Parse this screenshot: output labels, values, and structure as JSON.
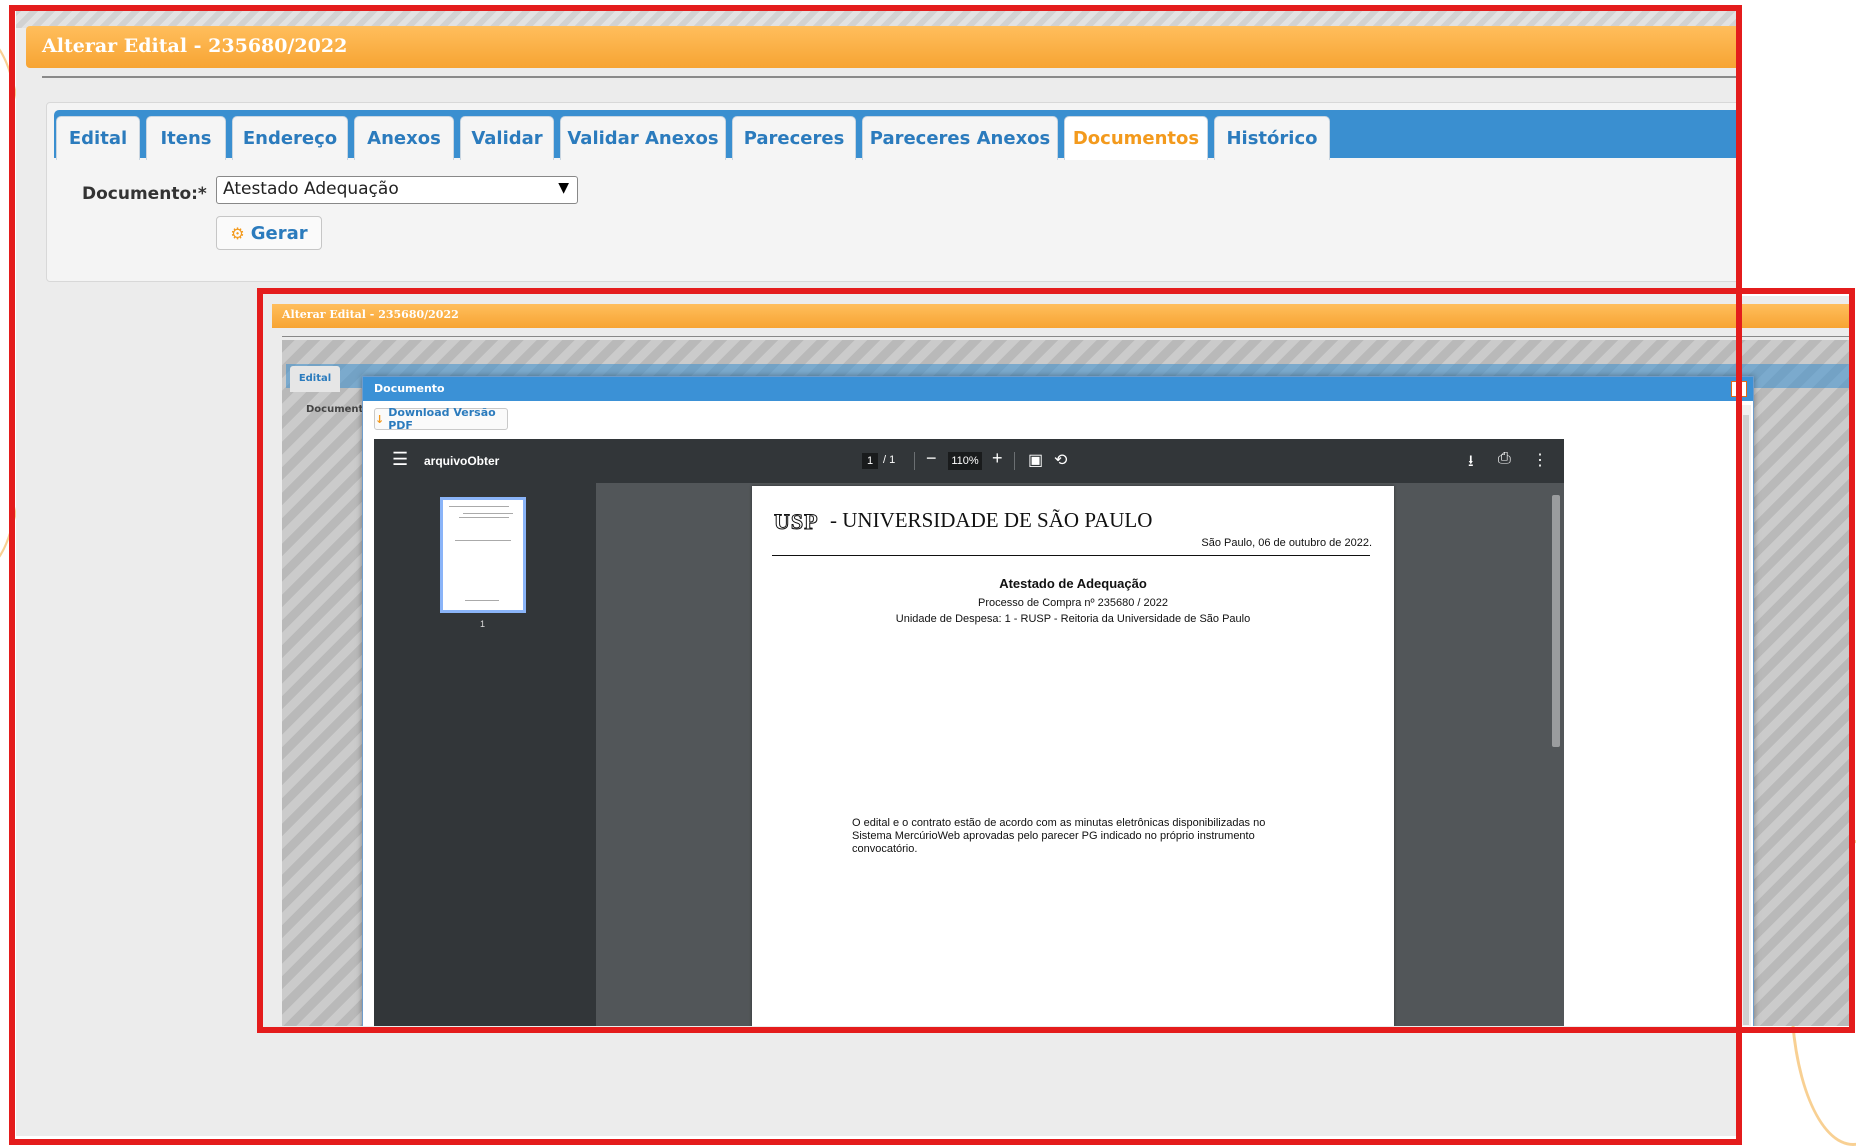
{
  "outer": {
    "title": "Alterar Edital - 235680/2022",
    "tabs": [
      {
        "label": "Edital"
      },
      {
        "label": "Itens"
      },
      {
        "label": "Endereço"
      },
      {
        "label": "Anexos"
      },
      {
        "label": "Validar"
      },
      {
        "label": "Validar Anexos"
      },
      {
        "label": "Pareceres"
      },
      {
        "label": "Pareceres Anexos"
      },
      {
        "label": "Documentos"
      },
      {
        "label": "Histórico"
      }
    ],
    "active_tab": "Documentos",
    "documento_label": "Documento:*",
    "documento_value": "Atestado Adequação",
    "gerar_label": "Gerar"
  },
  "inner": {
    "title": "Alterar Edital - 235680/2022",
    "tab_label": "Edital",
    "documento_label": "Document",
    "modal": {
      "title": "Documento",
      "close_glyph": "×",
      "download_label": "Download Versão PDF"
    },
    "viewer": {
      "file_name": "arquivoObter",
      "page_current": "1",
      "page_total": "/  1",
      "zoom": "110%",
      "thumbnail_page": "1"
    },
    "document": {
      "logo": "USP",
      "university": "- UNIVERSIDADE DE SÃO PAULO",
      "date": "São Paulo, 06 de outubro de 2022.",
      "title": "Atestado de Adequação",
      "process": "Processo de Compra nº 235680 / 2022",
      "unit": "Unidade de Despesa: 1 - RUSP - Reitoria da Universidade de São Paulo",
      "body": "O edital e o contrato estão de acordo com as minutas eletrônicas disponibilizadas no Sistema MercúrioWeb aprovadas pelo parecer PG indicado no próprio instrumento convocatório."
    }
  },
  "colors": {
    "title_bar": "#f7a433",
    "tab_bar": "#3a8fd0",
    "tab_text": "#2b7bbd",
    "active_tab_text": "#f39a1d",
    "highlight_frame": "#e41c1c",
    "viewer_toolbar": "#323639"
  },
  "icons": {
    "gerar": "gear-icon",
    "download_pdf": "download-arrow-icon",
    "select": "chevron-down-icon",
    "viewer_menu": "hamburger-icon",
    "viewer_download": "download-icon",
    "viewer_print": "print-icon",
    "viewer_more": "more-vert-icon",
    "fit": "fit-page-icon",
    "rotate": "rotate-icon"
  }
}
